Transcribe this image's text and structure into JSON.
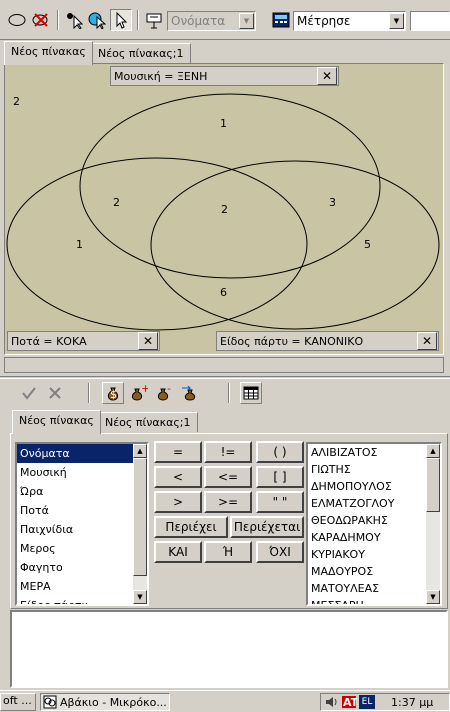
{
  "toolbar": {
    "objects_dropdown": "Ονόματα",
    "measure_dropdown": "Μέτρησε"
  },
  "top_tabs": [
    "Νέος πίνακας",
    "Νέος πίνακας;1"
  ],
  "venn": {
    "condition_top": "Μουσική = ΞΕΝΗ",
    "condition_left": "Ποτά = ΚΟΚΑ",
    "condition_right": "Είδος πάρτυ = ΚΑΝΟΝΙΚΟ",
    "outside_count": "2",
    "counts": {
      "top_only": "1",
      "top_left": "2",
      "center": "2",
      "top_right": "3",
      "left_only": "1",
      "right_only": "5",
      "left_right": "6"
    }
  },
  "bottom_tabs": [
    "Νέος πίνακας",
    "Νέος πίνακας;1"
  ],
  "fields": [
    "Ονόματα",
    "Μουσική",
    "Ώρα",
    "Ποτά",
    "Παιχνίδια",
    "Μερος",
    "Φαγητο",
    "ΜΕΡΑ",
    "Είδος πάρτυ"
  ],
  "selected_field": "Ονόματα",
  "operators": {
    "eq": "=",
    "neq": "!=",
    "paren": "( )",
    "lt": "<",
    "lte": "<=",
    "brackets": "[ ]",
    "gt": ">",
    "gte": ">=",
    "quotes": "\" \"",
    "contains": "Περιέχει",
    "contained": "Περιέχεται",
    "and": "ΚΑΙ",
    "or": "Ή",
    "not": "ΌΧΙ"
  },
  "values": [
    "ΑΛΙΒΙΖΑΤΟΣ",
    "ΓΙΩΤΗΣ",
    "ΔΗΜΟΠΟΥΛΟΣ",
    "ΕΛΜΑΤΖΟΓΛΟΥ",
    "ΘΕΟΔΩΡΑΚΗΣ",
    "ΚΑΡΑΔΗΜΟΥ",
    "ΚΥΡΙΑΚΟΥ",
    "ΜΑΔΟΥΡΟΣ",
    "ΜΑΤΟΥΛΕΑΣ",
    "ΜΕΣΣΑΡΗ"
  ],
  "taskbar": {
    "left_item": "oft ...",
    "task_item": "Αβάκιο - Μικρόκο...",
    "lang": "EL",
    "clock": "1:37 μμ"
  },
  "colors": {
    "venn_bg": "#c8c4a4",
    "selection": "#0a246a",
    "title_blue": "#0a246a"
  }
}
